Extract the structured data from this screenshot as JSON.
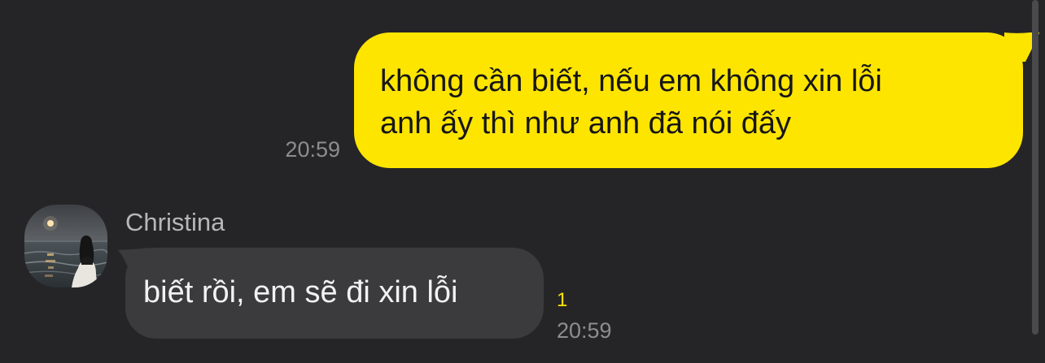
{
  "conversation": {
    "outgoing": {
      "text": "không cần biết, nếu em không xin lỗi\nanh ấy thì như anh đã nói đấy",
      "time": "20:59",
      "bubble_color": "#FEE500"
    },
    "incoming": {
      "sender": "Christina",
      "text": "biết rồi, em sẽ đi xin lỗi",
      "unread": "1",
      "time": "20:59",
      "bubble_color": "#3B3B3D"
    }
  },
  "theme": {
    "background": "#252527",
    "unread_color": "#FEE500",
    "time_color": "#8D8D8F"
  }
}
